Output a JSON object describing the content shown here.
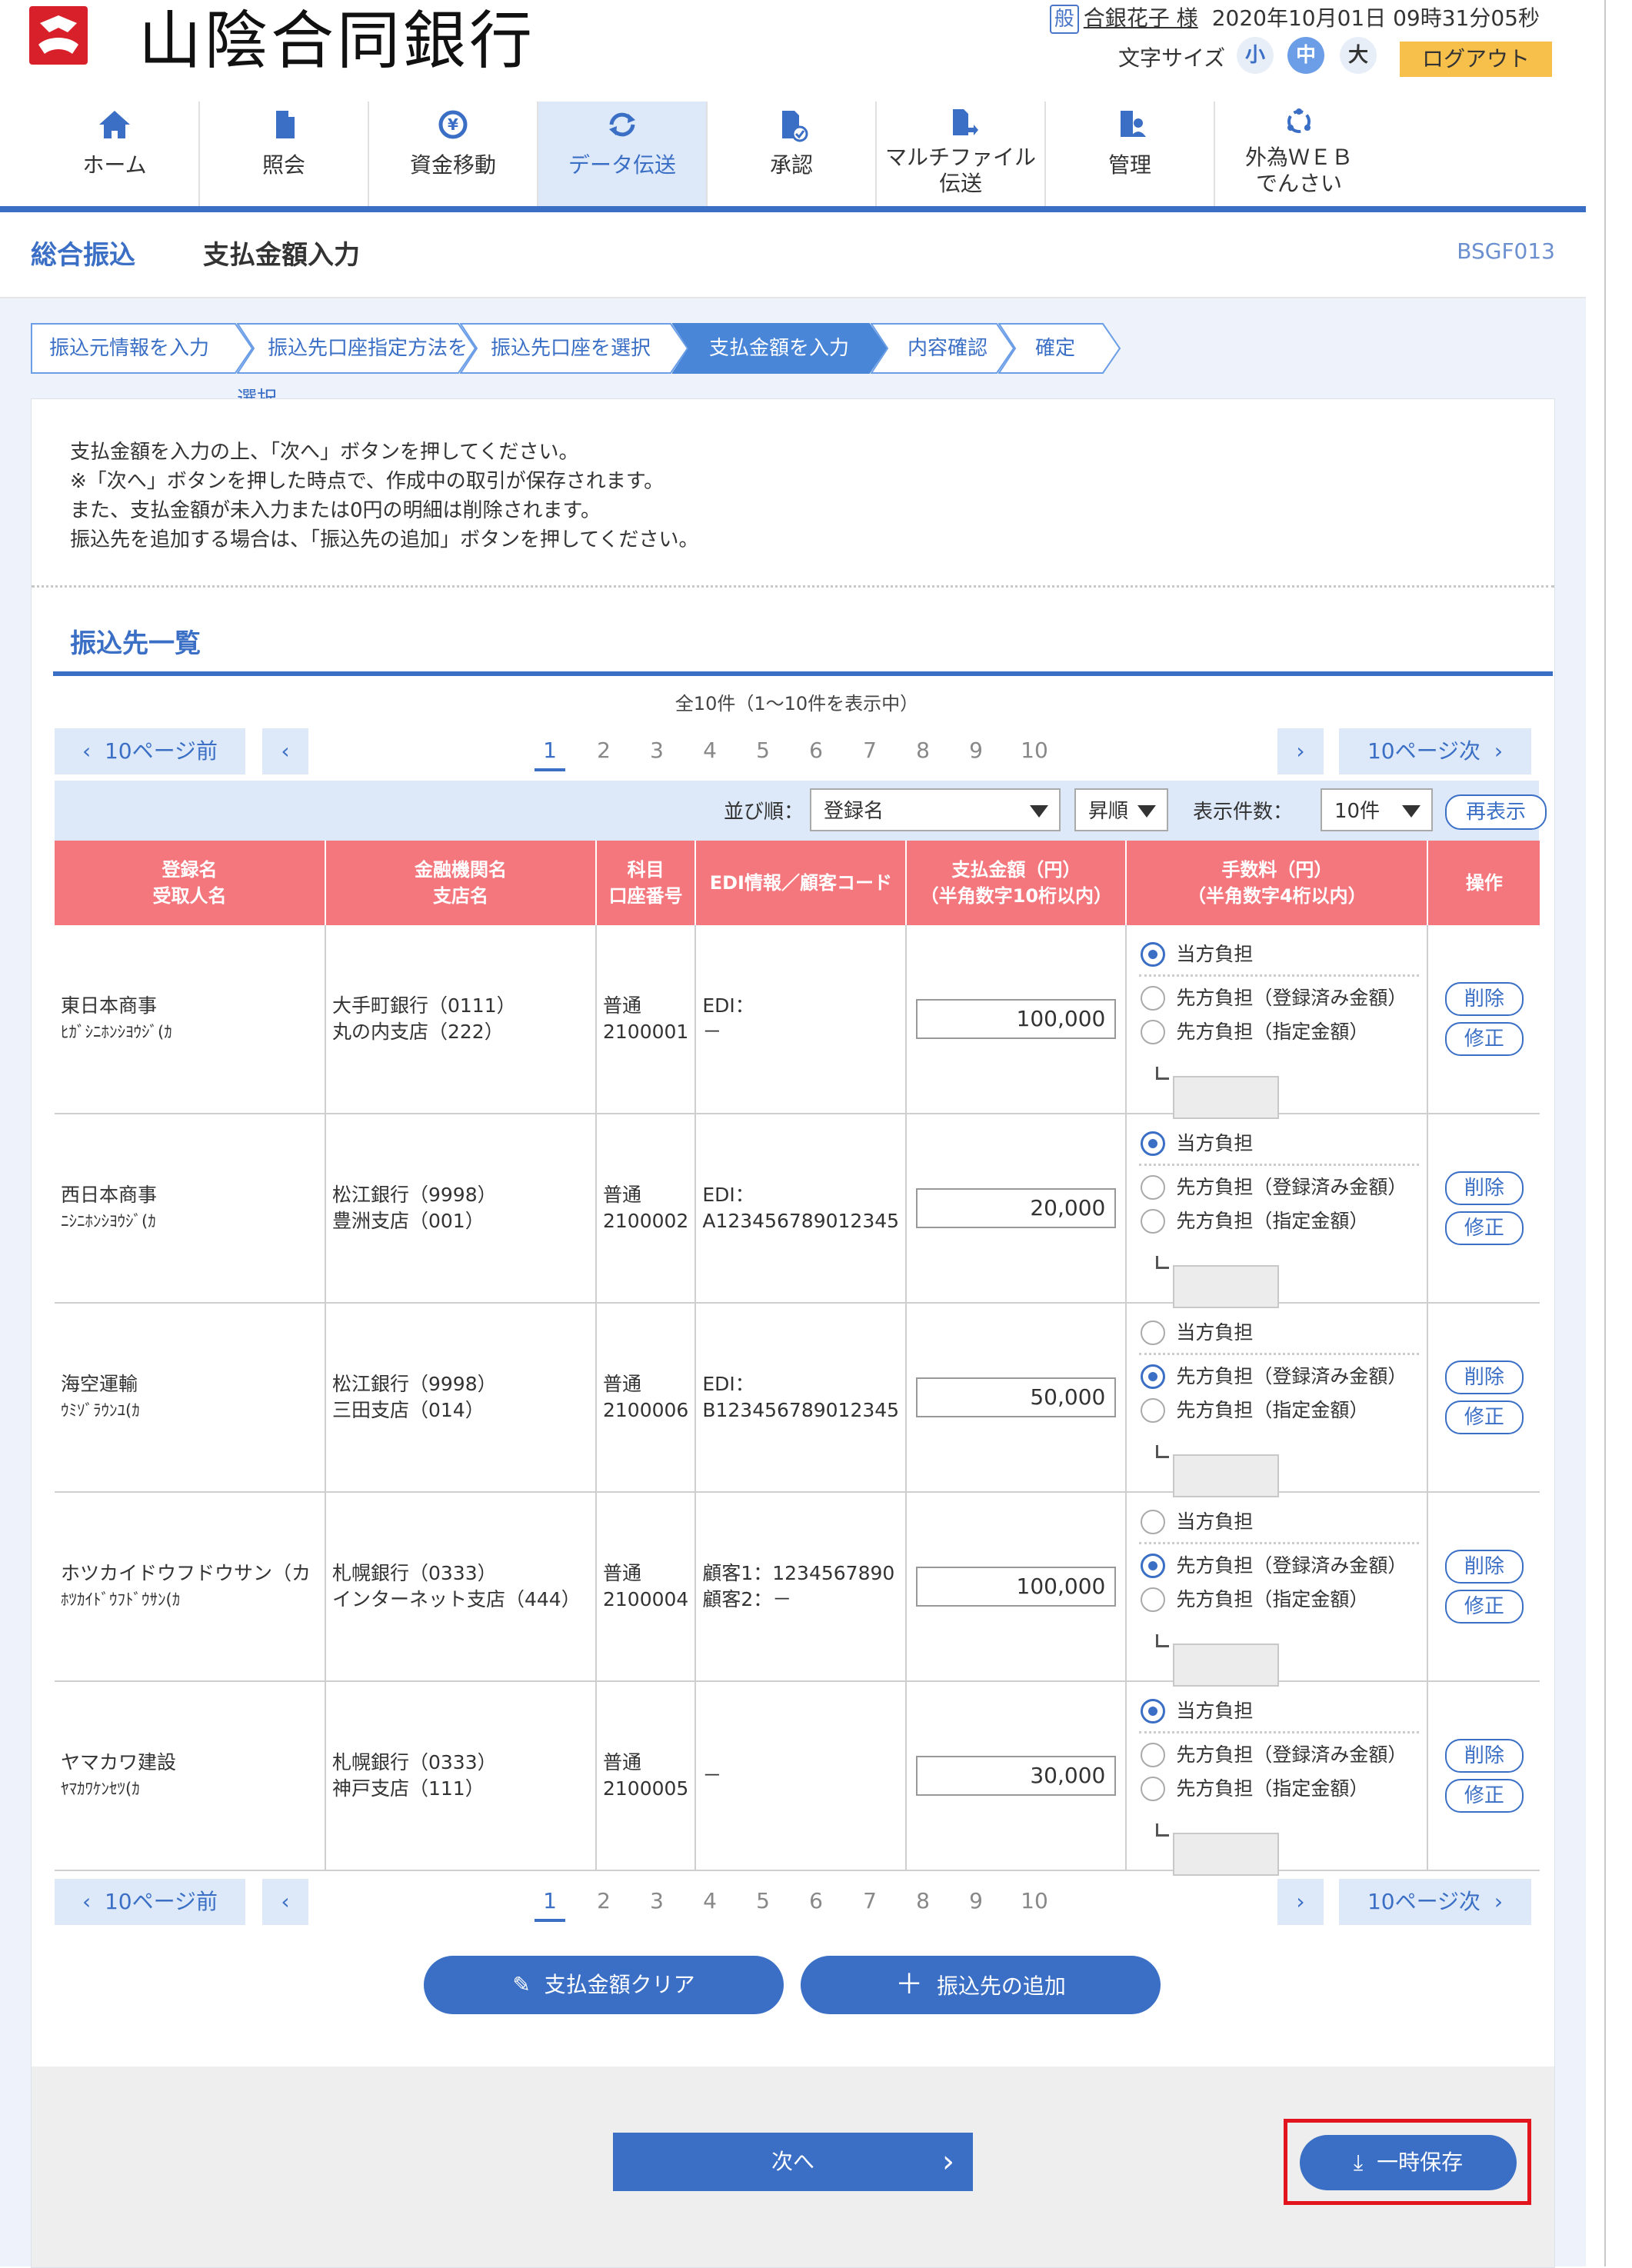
{
  "header": {
    "brand": "山陰合同銀行",
    "user_badge": "般",
    "user_name": "合銀花子 様",
    "datetime": "2020年10月01日 09時31分05秒",
    "font_size_label": "文字サイズ",
    "font_sizes": [
      "小",
      "中",
      "大"
    ],
    "logout": "ログアウト"
  },
  "nav": [
    {
      "label": "ホーム",
      "icon": "home-icon"
    },
    {
      "label": "照会",
      "icon": "document-icon"
    },
    {
      "label": "資金移動",
      "icon": "yen-transfer-icon"
    },
    {
      "label": "データ伝送",
      "icon": "refresh-icon",
      "active": true
    },
    {
      "label": "承認",
      "icon": "approve-icon"
    },
    {
      "label": "マルチファイル",
      "label2": "伝送",
      "icon": "file-transfer-icon"
    },
    {
      "label": "管理",
      "icon": "building-user-icon"
    },
    {
      "label": "外為ＷＥＢ",
      "label2": "でんさい",
      "icon": "network-icon"
    }
  ],
  "page": {
    "title": "総合振込",
    "subtitle": "支払金額入力",
    "screen_id": "BSGF013"
  },
  "steps": [
    "振込元情報を入力",
    "振込先口座指定方法を選択",
    "振込先口座を選択",
    "支払金額を入力",
    "内容確認",
    "確定"
  ],
  "instructions": [
    "支払金額を入力の上、「次へ」ボタンを押してください。",
    "※「次へ」ボタンを押した時点で、作成中の取引が保存されます。",
    "また、支払金額が未入力または0円の明細は削除されます。",
    "振込先を追加する場合は、「振込先の追加」ボタンを押してください。"
  ],
  "section_title": "振込先一覧",
  "pager": {
    "count_text": "全10件（1〜10件を表示中）",
    "prev10": "10ページ前",
    "next10": "10ページ次",
    "pages": [
      "1",
      "2",
      "3",
      "4",
      "5",
      "6",
      "7",
      "8",
      "9",
      "10"
    ],
    "current": "1"
  },
  "sort": {
    "order_label": "並び順：",
    "order_value": "登録名",
    "direction_value": "昇順",
    "count_label": "表示件数：",
    "count_value": "10件",
    "redisplay": "再表示"
  },
  "table": {
    "headers": {
      "name1": "登録名",
      "name2": "受取人名",
      "bank1": "金融機関名",
      "bank2": "支店名",
      "acct1": "科目",
      "acct2": "口座番号",
      "edi": "EDI情報／顧客コード",
      "amount1": "支払金額（円）",
      "amount2": "（半角数字10桁以内）",
      "fee1": "手数料（円）",
      "fee2": "（半角数字4桁以内）",
      "op": "操作"
    },
    "fee_options": [
      "当方負担",
      "先方負担（登録済み金額）",
      "先方負担（指定金額）"
    ],
    "op_delete": "削除",
    "op_edit": "修正",
    "rows": [
      {
        "name": "東日本商事",
        "kana": "ﾋｶﾞｼﾆﾎﾝｼﾖｳｼﾞ(ｶ",
        "bank": "大手町銀行（0111）",
        "branch": "丸の内支店（222）",
        "type": "普通",
        "acct": "2100001",
        "edi1": "EDI：",
        "edi2": "－",
        "amount": "100,000",
        "fee": 0
      },
      {
        "name": "西日本商事",
        "kana": "ﾆｼﾆﾎﾝｼﾖｳｼﾞ(ｶ",
        "bank": "松江銀行（9998）",
        "branch": "豊洲支店（001）",
        "type": "普通",
        "acct": "2100002",
        "edi1": "EDI：",
        "edi2": "A123456789012345",
        "amount": "20,000",
        "fee": 0
      },
      {
        "name": "海空運輸",
        "kana": "ｳﾐｿﾞﾗｳﾝﾕ(ｶ",
        "bank": "松江銀行（9998）",
        "branch": "三田支店（014）",
        "type": "普通",
        "acct": "2100006",
        "edi1": "EDI：",
        "edi2": "B123456789012345",
        "amount": "50,000",
        "fee": 1
      },
      {
        "name": "ホツカイドウフドウサン（カ",
        "kana": "ﾎﾂｶｲﾄﾞｳﾌﾄﾞｳｻﾝ(ｶ",
        "bank": "札幌銀行（0333）",
        "branch": "インターネット支店（444）",
        "type": "普通",
        "acct": "2100004",
        "edi1": "顧客1：1234567890",
        "edi2": "顧客2：－",
        "amount": "100,000",
        "fee": 1
      },
      {
        "name": "ヤマカワ建設",
        "kana": "ﾔﾏｶﾜｹﾝｾﾂ(ｶ",
        "bank": "札幌銀行（0333）",
        "branch": "神戸支店（111）",
        "type": "普通",
        "acct": "2100005",
        "edi1": "－",
        "edi2": "",
        "amount": "30,000",
        "fee": 0
      }
    ]
  },
  "buttons": {
    "clear": "支払金額クリア",
    "add": "振込先の追加",
    "next": "次へ",
    "temp_save": "一時保存"
  },
  "colors": {
    "accent": "#3a6fc5",
    "header_row": "#f4777e",
    "logout": "#f7c04a",
    "highlight": "#e2151f"
  }
}
